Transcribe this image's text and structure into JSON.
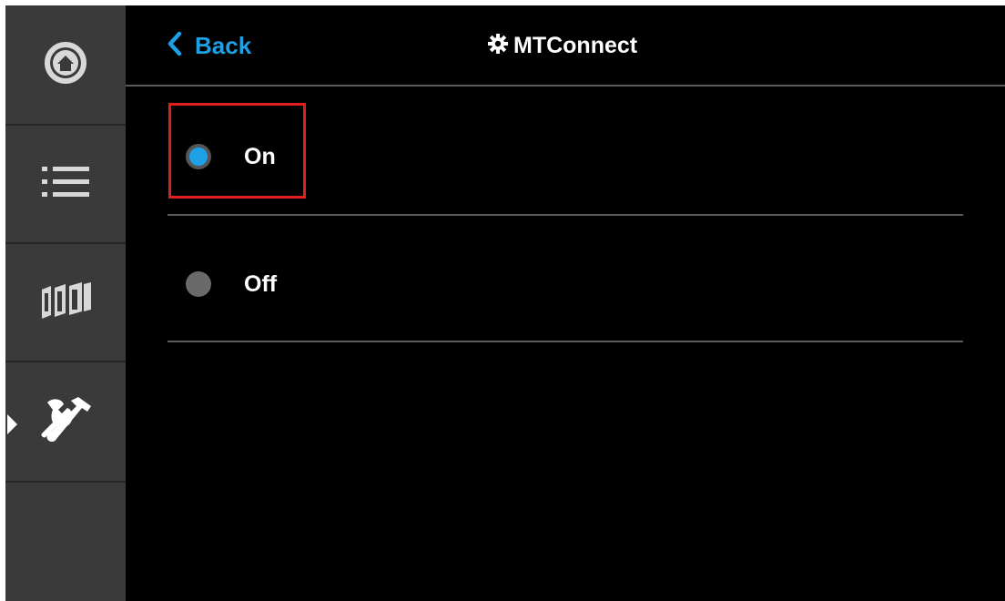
{
  "header": {
    "back_label": "Back",
    "title": "MTConnect",
    "back_icon": "chevron-left-icon",
    "title_icon": "gear-icon"
  },
  "sidebar": {
    "items": [
      {
        "icon": "home-icon",
        "active": false
      },
      {
        "icon": "list-icon",
        "active": false
      },
      {
        "icon": "tool-magazine-icon",
        "active": false
      },
      {
        "icon": "tools-icon",
        "active": true
      },
      {
        "icon": "",
        "active": false
      }
    ]
  },
  "options": [
    {
      "label": "On",
      "selected": true
    },
    {
      "label": "Off",
      "selected": false
    }
  ],
  "colors": {
    "accent": "#1ea0e6",
    "highlight": "#e01e1e",
    "sidebar": "#3a3a3a",
    "background": "#000000"
  }
}
